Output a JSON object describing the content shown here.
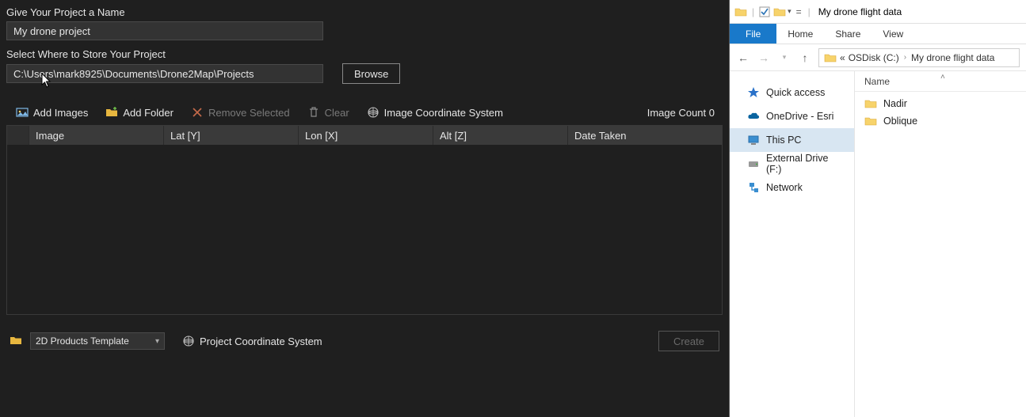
{
  "labels": {
    "project_name": "Give Your Project a Name",
    "store_where": "Select Where to Store Your Project"
  },
  "inputs": {
    "project_name_value": "My drone project",
    "store_path_value": "C:\\Users\\mark8925\\Documents\\Drone2Map\\Projects"
  },
  "buttons": {
    "browse": "Browse",
    "create": "Create"
  },
  "toolbar": {
    "add_images": "Add Images",
    "add_folder": "Add Folder",
    "remove_selected": "Remove Selected",
    "clear": "Clear",
    "image_coord": "Image Coordinate System",
    "image_count_label": "Image Count",
    "image_count_value": 0
  },
  "table": {
    "columns": {
      "image": "Image",
      "lat": "Lat [Y]",
      "lon": "Lon [X]",
      "alt": "Alt [Z]",
      "date": "Date Taken"
    },
    "rows": []
  },
  "footer": {
    "template": "2D Products Template",
    "project_coord": "Project Coordinate System"
  },
  "explorer": {
    "title": "My drone flight data",
    "tabs": {
      "file": "File",
      "home": "Home",
      "share": "Share",
      "view": "View"
    },
    "breadcrumb": {
      "prefix": "«",
      "drive": "OSDisk (C:)",
      "folder": "My drone flight data"
    },
    "nav": {
      "quick": "Quick access",
      "onedrive": "OneDrive - Esri",
      "thispc": "This PC",
      "external": "External Drive (F:)",
      "network": "Network"
    },
    "content": {
      "col_name": "Name",
      "items": [
        "Nadir",
        "Oblique"
      ]
    }
  }
}
